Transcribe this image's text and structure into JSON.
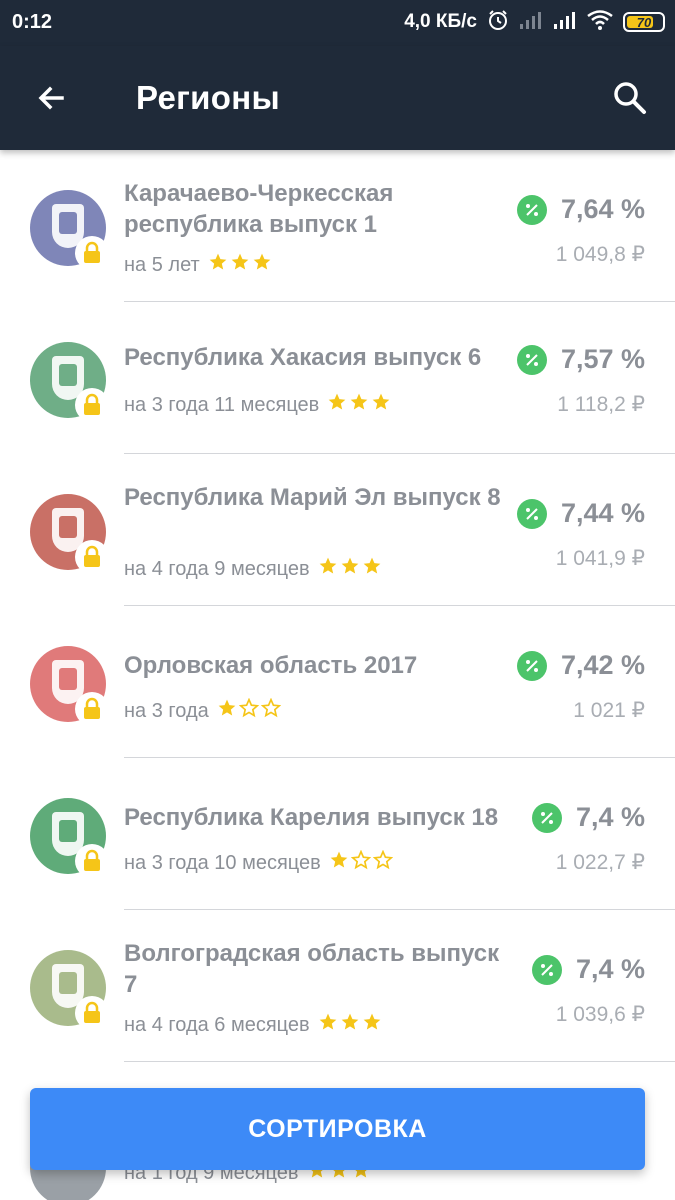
{
  "status_bar": {
    "time": "0:12",
    "speed": "4,0 КБ/с",
    "battery": "70",
    "icons": [
      "alarm-icon",
      "signal-icon",
      "signal-icon",
      "wifi-icon",
      "battery-icon"
    ]
  },
  "app_bar": {
    "title": "Регионы",
    "back_icon": "arrow-left-icon",
    "search_icon": "search-icon"
  },
  "colors": {
    "app_bar_bg": "#1f2a39",
    "accent_blue": "#3d8af7",
    "badge_green": "#4cc46a",
    "star_yellow": "#f5c518",
    "text_gray": "#8b8f96"
  },
  "bonds": [
    {
      "name": "Карачаево-Черкесская республика выпуск 1",
      "term": "на 5 лет",
      "rating": 3,
      "rate": "7,64 %",
      "price": "1 049,8 ₽",
      "emblem_color": "#7f86b8"
    },
    {
      "name": "Республика Хакасия выпуск 6",
      "term": "на 3 года 11 месяцев",
      "rating": 3,
      "rate": "7,57 %",
      "price": "1 118,2 ₽",
      "emblem_color": "#6fae87"
    },
    {
      "name": "Республика Марий Эл выпуск 8",
      "term": "на 4 года 9 месяцев",
      "rating": 3,
      "rate": "7,44 %",
      "price": "1 041,9 ₽",
      "emblem_color": "#c97066"
    },
    {
      "name": "Орловская область 2017",
      "term": "на 3 года",
      "rating": 1,
      "rate": "7,42 %",
      "price": "1 021 ₽",
      "emblem_color": "#e07a7a"
    },
    {
      "name": "Республика Карелия выпуск 18",
      "term": "на 3 года 10 месяцев",
      "rating": 1,
      "rate": "7,4 %",
      "price": "1 022,7 ₽",
      "emblem_color": "#5fab79"
    },
    {
      "name": "Волгоградская область выпуск 7",
      "term": "на 4 года 6 месяцев",
      "rating": 3,
      "rate": "7,4 %",
      "price": "1 039,6 ₽",
      "emblem_color": "#a9bb8c"
    }
  ],
  "peek_row": {
    "term": "на 1 год 9 месяцев",
    "rating": 3
  },
  "sort_button": {
    "label": "СОРТИРОВКА"
  }
}
